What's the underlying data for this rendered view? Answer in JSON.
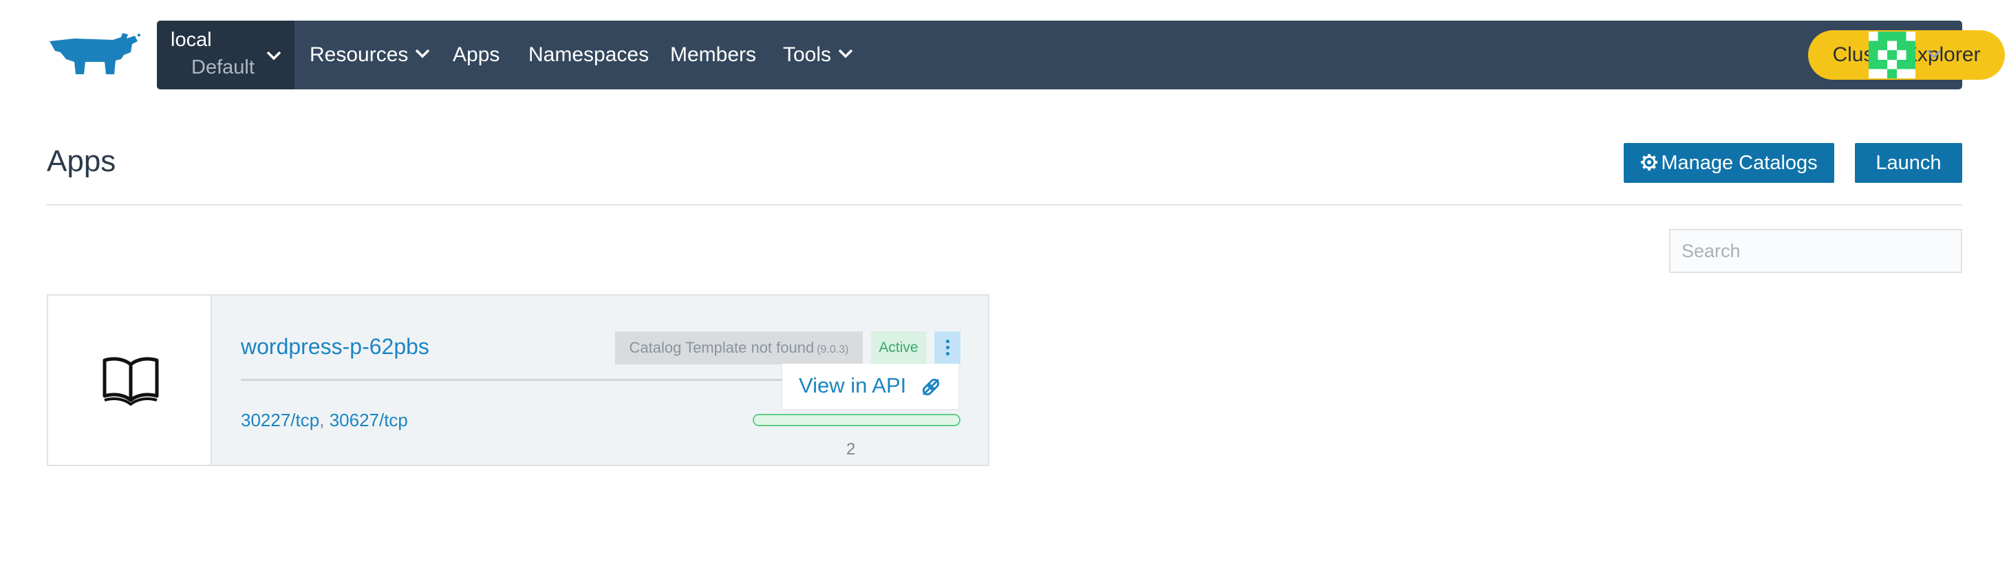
{
  "brand": {
    "logo_icon": "rancher-cow-logo-icon",
    "color": "#1a81bd"
  },
  "navbar": {
    "cluster": {
      "name": "local",
      "project": "Default"
    },
    "items": [
      {
        "label": "Resources",
        "has_dropdown": true
      },
      {
        "label": "Apps",
        "has_dropdown": false
      },
      {
        "label": "Namespaces",
        "has_dropdown": false
      },
      {
        "label": "Members",
        "has_dropdown": false
      },
      {
        "label": "Tools",
        "has_dropdown": true
      }
    ],
    "cluster_explorer_label": "Cluster Explorer",
    "background": "#34475d",
    "accent": "#f5c418"
  },
  "page": {
    "title": "Apps",
    "manage_catalogs_label": "Manage Catalogs",
    "launch_label": "Launch",
    "search_placeholder": "Search"
  },
  "apps": [
    {
      "name": "wordpress-p-62pbs",
      "icon": "book-icon",
      "catalog_status": "Catalog Template not found",
      "version": "(9.0.3)",
      "state": "Active",
      "ports": [
        "30227/tcp",
        "30627/tcp"
      ],
      "port_separator": ",",
      "progress_fraction": 1.0,
      "count": "2"
    }
  ],
  "tooltip": {
    "label": "View in API",
    "icon": "external-api-icon"
  }
}
